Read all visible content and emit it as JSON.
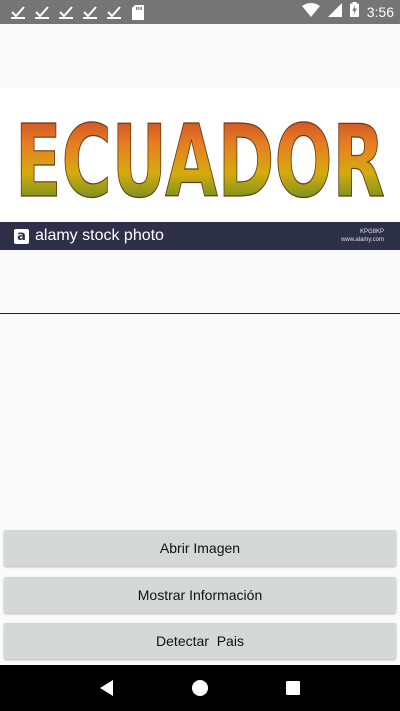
{
  "status_bar": {
    "notification_icons": [
      "check-icon",
      "check-icon",
      "check-icon",
      "check-icon",
      "check-icon",
      "sd-card-icon"
    ],
    "system_icons": [
      "wifi-icon",
      "signal-icon",
      "battery-icon"
    ],
    "time": "3:56"
  },
  "image": {
    "word": "ECUADOR",
    "watermark": {
      "logo_letter": "a",
      "text": "alamy stock photo",
      "code": "KPG8KP",
      "site": "www.alamy.com"
    }
  },
  "buttons": {
    "open_image": "Abrir Imagen",
    "show_info": "Mostrar Información",
    "detect_country": "Detectar  Pais"
  },
  "nav_bar": {
    "icons": [
      "back-icon",
      "home-icon",
      "recents-icon"
    ]
  },
  "colors": {
    "status_bar": "#757575",
    "button_bg": "#d6d7d7",
    "watermark_bar": "#2e2f48",
    "nav_bar": "#000000"
  }
}
